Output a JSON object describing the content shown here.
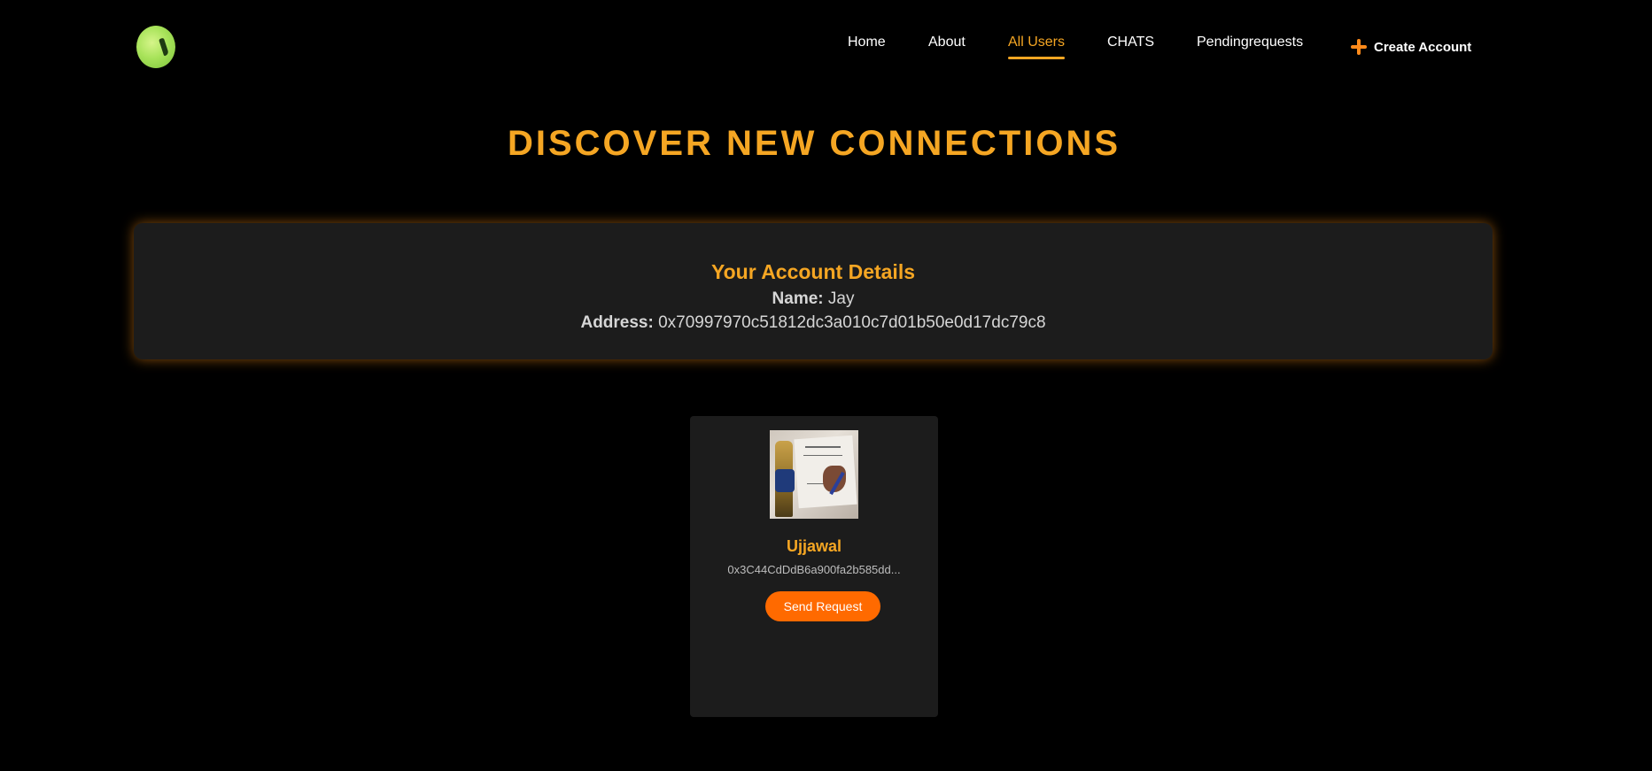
{
  "header": {
    "logo_icon": "green-apple-logo-icon",
    "nav": [
      {
        "label": "Home",
        "active": false
      },
      {
        "label": "About",
        "active": false
      },
      {
        "label": "All Users",
        "active": true
      },
      {
        "label": "CHATS",
        "active": false
      },
      {
        "label": "Pendingrequests",
        "active": false
      }
    ],
    "create_account": {
      "label": "Create Account",
      "icon": "plus-icon"
    }
  },
  "page_title": "DISCOVER NEW CONNECTIONS",
  "account": {
    "heading": "Your Account Details",
    "name_label": "Name:",
    "name_value": "Jay",
    "address_label": "Address:",
    "address_value": "0x70997970c51812dc3a010c7d01b50e0d17dc79c8"
  },
  "users": [
    {
      "name": "Ujjawal",
      "address": "0x3C44CdDdB6a900fa2b585dd...",
      "action_label": "Send Request"
    }
  ],
  "colors": {
    "accent": "#f5a623",
    "button": "#ff6a00",
    "background": "#000000",
    "panel": "#1c1c1c"
  }
}
